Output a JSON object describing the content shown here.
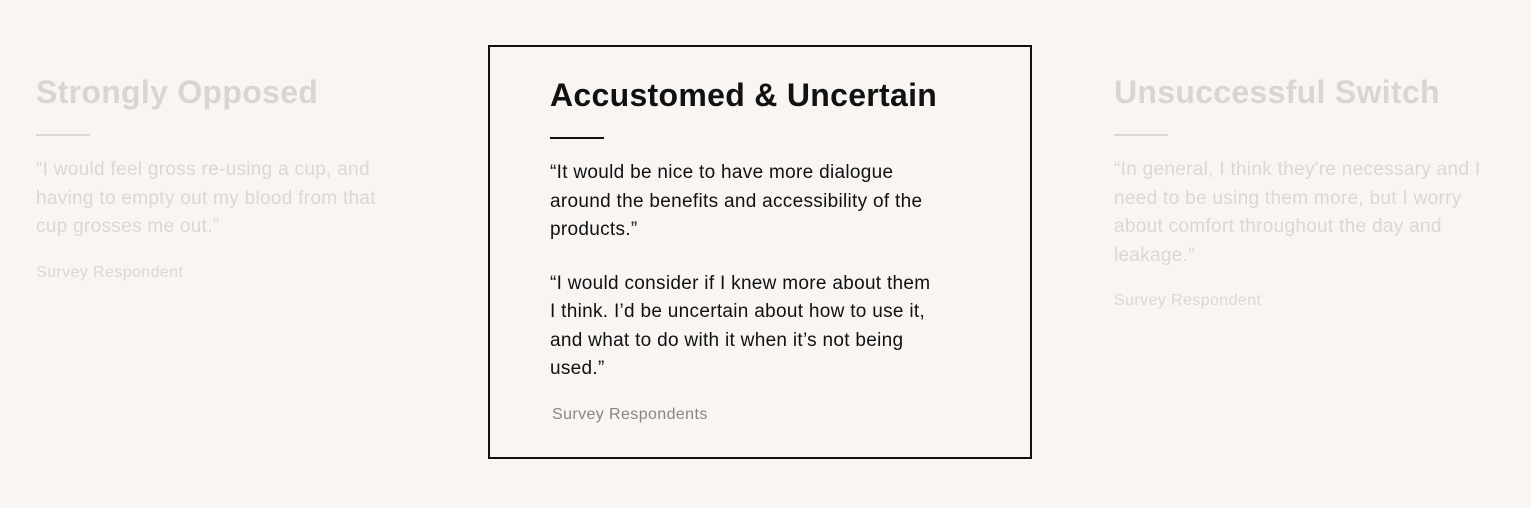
{
  "cards": [
    {
      "title": "Strongly Opposed",
      "quotes": [
        "“I would feel gross re-using a cup, and having to empty out my blood from that cup grosses me out.”"
      ],
      "attribution": "Survey Respondent"
    },
    {
      "title": "Accustomed & Uncertain",
      "quotes": [
        "“It would be nice to have more dialogue around the benefits and accessibility of the products.”",
        "“I would consider if I knew more about them I think. I’d be uncertain about how to use it, and what to do with it when it’s not being used.”"
      ],
      "attribution": "Survey Respondents"
    },
    {
      "title": "Unsuccessful Switch",
      "quotes": [
        "“In general, I think they're necessary and I need to be using them more, but I worry about comfort throughout the day and leakage.”"
      ],
      "attribution": "Survey Respondent"
    }
  ],
  "colors": {
    "background": "#f8f5f3",
    "active_text": "#111111",
    "faded_text": "#dcd7d5",
    "attribution_active": "#8a8583"
  }
}
